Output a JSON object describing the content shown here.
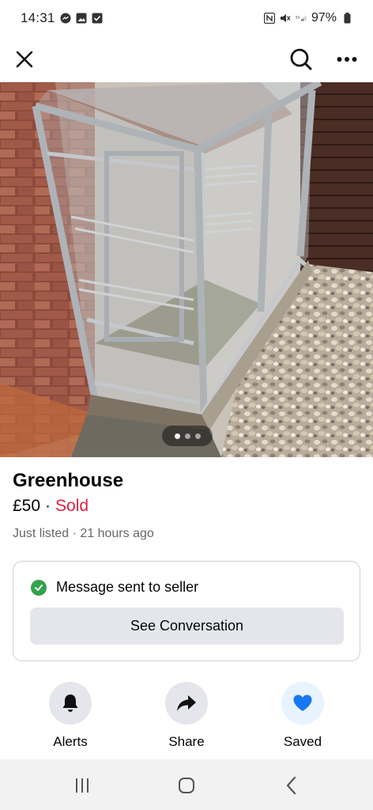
{
  "status_bar": {
    "time": "14:31",
    "battery": "97%"
  },
  "listing": {
    "title": "Greenhouse",
    "price": "£50",
    "separator": "·",
    "status": "Sold",
    "listed": "Just listed · 21 hours ago"
  },
  "photo": {
    "image_count": 3,
    "current_index": 1
  },
  "message_card": {
    "text": "Message sent to seller",
    "button": "See Conversation"
  },
  "actions": {
    "alerts": "Alerts",
    "share": "Share",
    "saved": "Saved"
  },
  "colors": {
    "sold": "#e41e3f",
    "check": "#31a24c",
    "saved_heart": "#1877f2"
  },
  "icons": [
    "close-icon",
    "search-icon",
    "more-icon",
    "bell-icon",
    "share-icon",
    "heart-icon",
    "recent-apps-icon",
    "home-icon",
    "back-icon"
  ]
}
